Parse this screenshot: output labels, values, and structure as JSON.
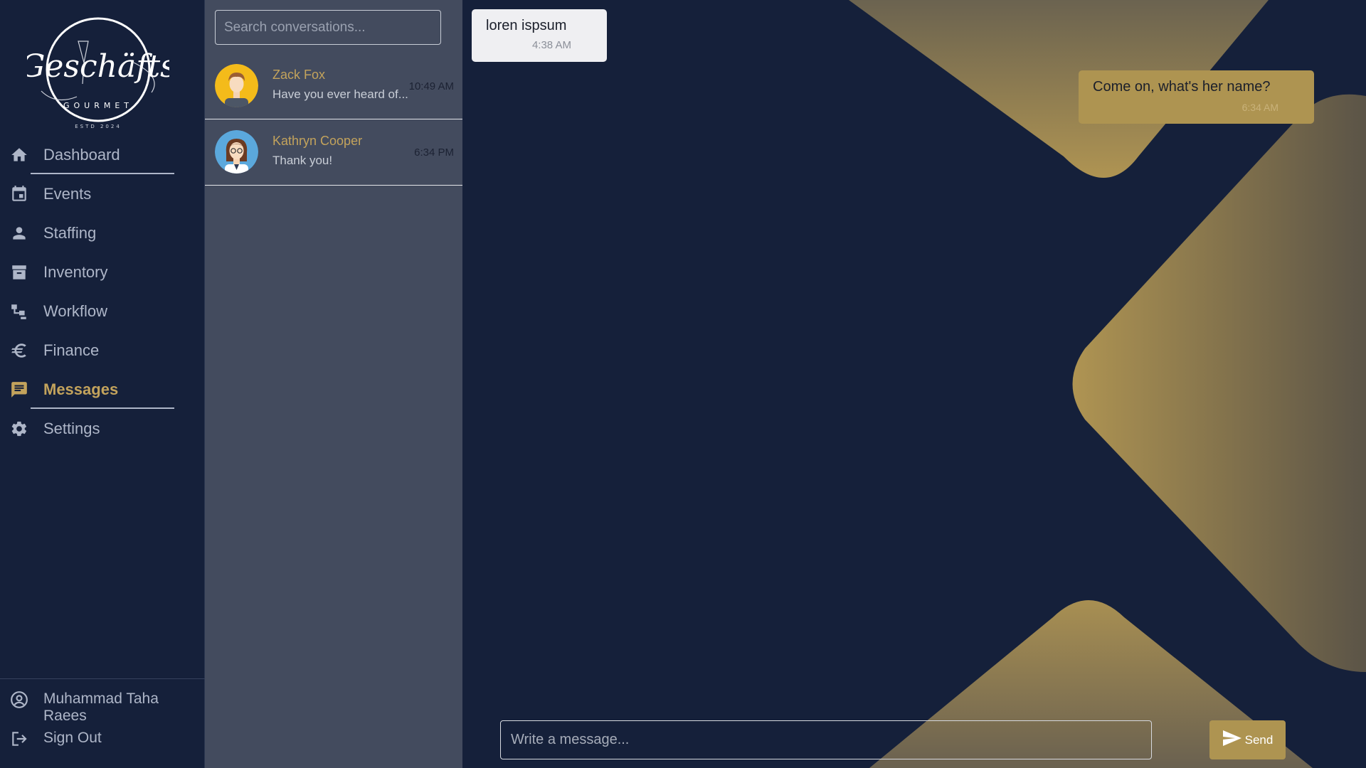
{
  "brand": {
    "logo_text": "Geschäfts",
    "logo_subtext": "GOURMET",
    "logo_established": "ESTD 2024",
    "accent_color": "#c3a35c",
    "background_color": "#15203a"
  },
  "sidebar": {
    "items": [
      {
        "label": "Dashboard",
        "icon": "home-icon",
        "active": false
      },
      {
        "label": "Events",
        "icon": "calendar-icon",
        "active": false
      },
      {
        "label": "Staffing",
        "icon": "person-icon",
        "active": false
      },
      {
        "label": "Inventory",
        "icon": "archive-icon",
        "active": false
      },
      {
        "label": "Workflow",
        "icon": "workflow-icon",
        "active": false
      },
      {
        "label": "Finance",
        "icon": "euro-icon",
        "active": false
      },
      {
        "label": "Messages",
        "icon": "chat-icon",
        "active": true
      },
      {
        "label": "Settings",
        "icon": "gear-icon",
        "active": false
      }
    ],
    "user_name": "Muhammad Taha Raees",
    "sign_out_label": "Sign Out"
  },
  "conversations": {
    "search_placeholder": "Search conversations...",
    "items": [
      {
        "name": "Zack Fox",
        "preview": "Have you ever heard of...",
        "time": "10:49 AM"
      },
      {
        "name": "Kathryn Cooper",
        "preview": "Thank you!",
        "time": "6:34 PM"
      }
    ]
  },
  "chat": {
    "messages": [
      {
        "direction": "incoming",
        "text": "loren ispsum",
        "time": "4:38 AM"
      },
      {
        "direction": "outgoing",
        "text": "Come on, what's her name?",
        "time": "6:34 AM"
      }
    ],
    "compose_placeholder": "Write a message...",
    "send_label": "Send"
  }
}
